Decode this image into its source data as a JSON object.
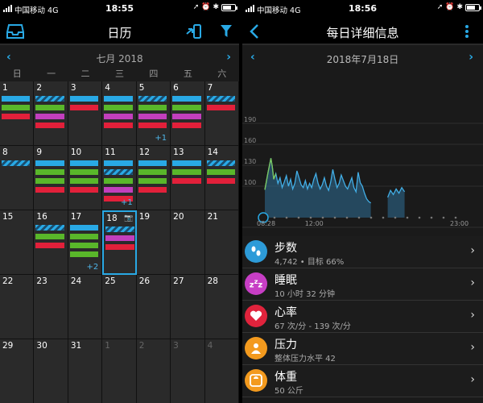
{
  "status_left": {
    "carrier": "中国移动",
    "network": "4G",
    "time": "18:55"
  },
  "status_right": {
    "carrier": "中国移动",
    "network": "4G",
    "time": "18:56"
  },
  "calendar": {
    "title": "日历",
    "month_label": "七月 2018",
    "weekdays": [
      "日",
      "一",
      "二",
      "三",
      "四",
      "五",
      "六"
    ],
    "weeks": [
      [
        {
          "n": "1",
          "bars": [
            "blue",
            "green",
            "red"
          ]
        },
        {
          "n": "2",
          "bars": [
            "stripe",
            "green",
            "mag",
            "red"
          ]
        },
        {
          "n": "3",
          "bars": [
            "blue",
            "red"
          ]
        },
        {
          "n": "4",
          "bars": [
            "blue",
            "green",
            "mag",
            "red"
          ]
        },
        {
          "n": "5",
          "bars": [
            "stripe",
            "green",
            "mag",
            "red"
          ],
          "more": "+1"
        },
        {
          "n": "6",
          "bars": [
            "blue",
            "green",
            "mag",
            "red"
          ]
        },
        {
          "n": "7",
          "bars": [
            "stripe",
            "red"
          ]
        }
      ],
      [
        {
          "n": "8",
          "bars": [
            "stripe"
          ]
        },
        {
          "n": "9",
          "bars": [
            "blue",
            "green",
            "green",
            "red"
          ]
        },
        {
          "n": "10",
          "bars": [
            "blue",
            "green",
            "green",
            "red"
          ]
        },
        {
          "n": "11",
          "bars": [
            "blue",
            "stripe",
            "green",
            "mag",
            "red"
          ],
          "more": "+1"
        },
        {
          "n": "12",
          "bars": [
            "blue",
            "green",
            "green",
            "red"
          ]
        },
        {
          "n": "13",
          "bars": [
            "blue",
            "green",
            "red"
          ]
        },
        {
          "n": "14",
          "bars": [
            "stripe",
            "green",
            "red"
          ]
        }
      ],
      [
        {
          "n": "15",
          "bars": []
        },
        {
          "n": "16",
          "bars": [
            "stripe",
            "green",
            "red"
          ]
        },
        {
          "n": "17",
          "bars": [
            "blue",
            "green",
            "green",
            "green"
          ],
          "more": "+2"
        },
        {
          "n": "18",
          "bars": [
            "stripe",
            "mag",
            "red"
          ],
          "selected": true,
          "camera": true
        },
        {
          "n": "19",
          "bars": []
        },
        {
          "n": "20",
          "bars": []
        },
        {
          "n": "21",
          "bars": []
        }
      ],
      [
        {
          "n": "22",
          "bars": []
        },
        {
          "n": "23",
          "bars": []
        },
        {
          "n": "24",
          "bars": []
        },
        {
          "n": "25",
          "bars": []
        },
        {
          "n": "26",
          "bars": []
        },
        {
          "n": "27",
          "bars": []
        },
        {
          "n": "28",
          "bars": []
        }
      ],
      [
        {
          "n": "29",
          "bars": []
        },
        {
          "n": "30",
          "bars": []
        },
        {
          "n": "31",
          "bars": []
        },
        {
          "n": "1",
          "bars": [],
          "dim": true
        },
        {
          "n": "2",
          "bars": [],
          "dim": true
        },
        {
          "n": "3",
          "bars": [],
          "dim": true
        },
        {
          "n": "4",
          "bars": [],
          "dim": true
        }
      ]
    ]
  },
  "detail": {
    "title": "每日详细信息",
    "date_label": "2018年7月18日",
    "items": [
      {
        "name": "步数",
        "sub": "4,742 • 目标 66%",
        "icon": "footprints-icon",
        "color": "#2d9bd8"
      },
      {
        "name": "睡眠",
        "sub": "10 小时 32 分钟",
        "icon": "sleep-icon",
        "color": "#c73ec5"
      },
      {
        "name": "心率",
        "sub": "67 次/分 - 139 次/分",
        "icon": "heart-icon",
        "color": "#e0233c"
      },
      {
        "name": "压力",
        "sub": "整体压力水平 42",
        "icon": "stress-icon",
        "color": "#f39a1e"
      },
      {
        "name": "体重",
        "sub": "50 公斤",
        "icon": "scale-icon",
        "color": "#f39a1e"
      }
    ]
  },
  "chart_data": {
    "type": "area",
    "title": "",
    "xlabel": "",
    "ylabel": "",
    "y_ticks": [
      "190",
      "160",
      "130",
      "100"
    ],
    "x_ticks": [
      "08:28",
      "12:00",
      "23:00"
    ],
    "ylim": [
      55,
      205
    ],
    "xlim": [
      8.47,
      23.0
    ],
    "grid": true,
    "colors": {
      "line": "#42aee6",
      "area": "#2f6f97",
      "spike": "#7ec85a"
    },
    "series": [
      {
        "x": [
          8.47,
          8.7,
          8.9,
          9.0,
          9.1,
          9.25,
          9.4,
          9.55,
          9.7,
          9.85,
          10.0,
          10.15,
          10.3,
          10.45,
          10.6,
          10.75,
          10.9,
          11.05,
          11.2,
          11.35,
          11.5,
          11.65,
          11.8,
          11.95,
          12.1,
          12.25,
          12.4,
          12.55,
          12.7,
          12.85,
          13.0,
          13.15,
          13.3,
          13.45,
          13.6,
          13.75,
          13.9,
          14.05,
          14.2,
          14.35,
          14.5,
          14.65,
          14.8,
          14.95,
          15.1,
          15.25,
          15.4,
          15.55,
          15.7,
          15.85,
          16.0
        ],
        "y": [
          95,
          120,
          140,
          128,
          110,
          118,
          104,
          112,
          98,
          106,
          115,
          100,
          110,
          96,
          104,
          122,
          112,
          102,
          98,
          108,
          96,
          104,
          98,
          110,
          118,
          104,
          96,
          102,
          112,
          100,
          94,
          106,
          124,
          110,
          98,
          104,
          116,
          108,
          100,
          96,
          104,
          112,
          98,
          92,
          120,
          105,
          100,
          90,
          82,
          78,
          76
        ]
      },
      {
        "x": [
          17.2,
          17.4,
          17.6,
          17.8,
          18.0,
          18.2,
          18.4
        ],
        "y": [
          84,
          94,
          88,
          96,
          90,
          98,
          92
        ]
      }
    ]
  }
}
